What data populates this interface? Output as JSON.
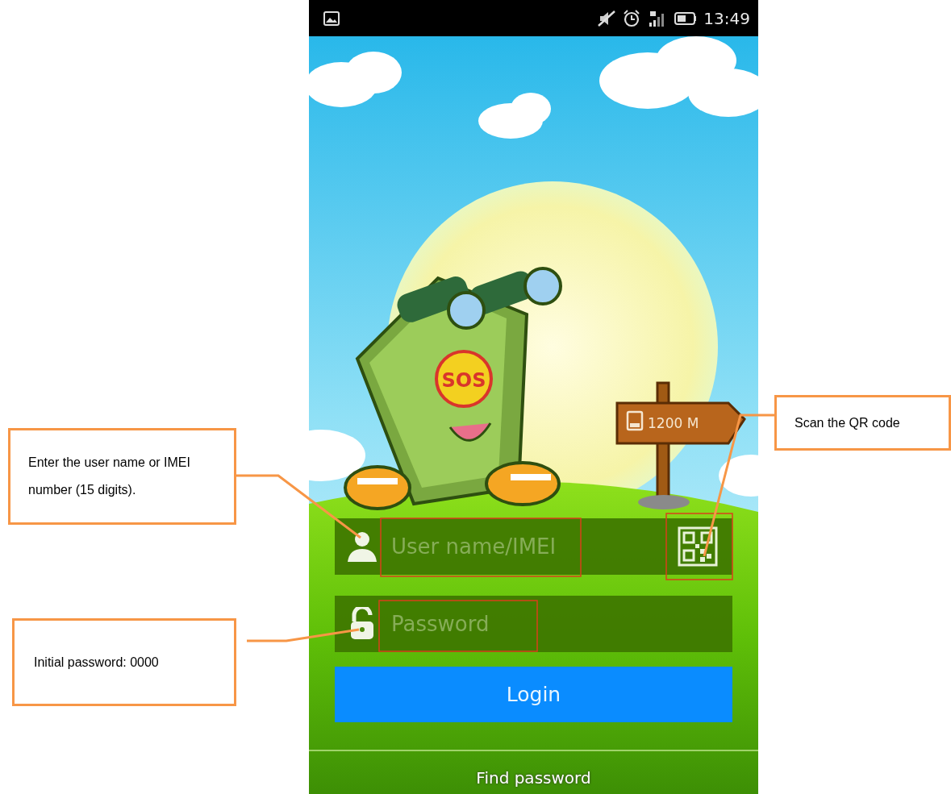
{
  "status_bar": {
    "time": "13:49"
  },
  "illustration": {
    "mascot_label": "SOS",
    "sign_text": "1200 M"
  },
  "form": {
    "username": {
      "placeholder": "User name/IMEI"
    },
    "password": {
      "placeholder": "Password"
    },
    "login_button": "Login",
    "find_password": "Find password"
  },
  "annotations": [
    {
      "text": "Enter the user name or IMEI number (15 digits)."
    },
    {
      "text": "Initial password: 0000"
    },
    {
      "text": "Scan the QR code"
    }
  ]
}
